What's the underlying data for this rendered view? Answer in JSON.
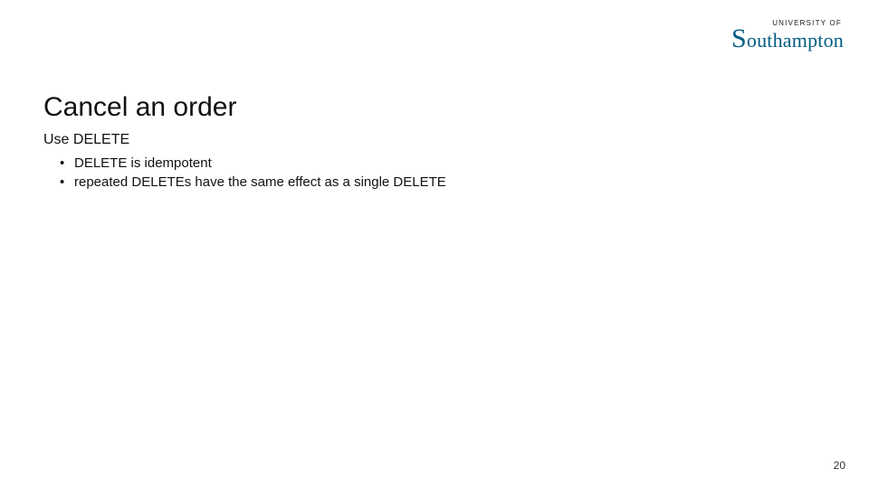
{
  "logo": {
    "supertitle": "UNIVERSITY OF",
    "initial": "S",
    "rest": "outhampton"
  },
  "title": "Cancel an order",
  "body": {
    "lead": "Use DELETE",
    "bullets": [
      "DELETE is idempotent",
      "repeated DELETEs have the same effect as a single DELETE"
    ]
  },
  "page_number": "20"
}
